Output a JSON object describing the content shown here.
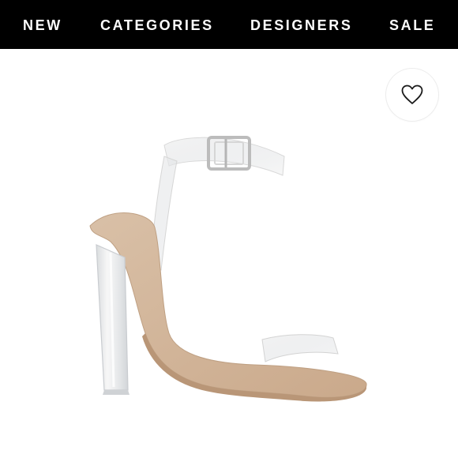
{
  "nav": {
    "items": [
      {
        "label": "NEW"
      },
      {
        "label": "CATEGORIES"
      },
      {
        "label": "DESIGNERS"
      },
      {
        "label": "SALE"
      }
    ]
  },
  "product": {
    "wishlist_icon": "heart-outline-icon",
    "image": "clear-block-heel-sandal-nude"
  },
  "colors": {
    "nav_background": "#000000",
    "nav_text": "#ffffff",
    "page_background": "#ffffff"
  }
}
